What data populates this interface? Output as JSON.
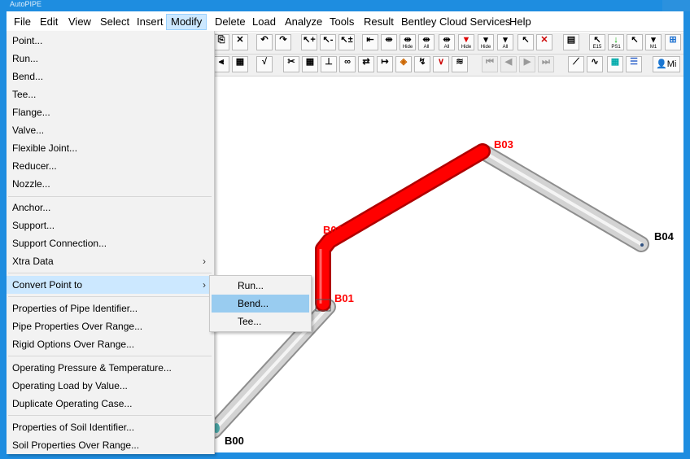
{
  "window": {
    "title": "AutoPIPE"
  },
  "menu_bar": [
    "File",
    "Edit",
    "View",
    "Select",
    "Insert",
    "Modify",
    "Delete",
    "Load",
    "Analyze",
    "Tools",
    "Result",
    "Bentley Cloud Services",
    "Help"
  ],
  "active_menu": "Modify",
  "modify_menu": {
    "group1": [
      "Point...",
      "Run...",
      "Bend...",
      "Tee...",
      "Flange...",
      "Valve...",
      "Flexible Joint...",
      "Reducer...",
      "Nozzle..."
    ],
    "group2": [
      "Anchor...",
      "Support...",
      "Support Connection...",
      "Xtra Data"
    ],
    "group3": [
      "Convert Point to"
    ],
    "group4": [
      "Properties of Pipe Identifier...",
      "Pipe Properties Over Range...",
      "Rigid Options Over Range..."
    ],
    "group5": [
      "Operating Pressure & Temperature...",
      "Operating Load by Value...",
      "Duplicate Operating Case..."
    ],
    "group6": [
      "Properties of Soil Identifier...",
      "Soil Properties Over Range..."
    ]
  },
  "convert_submenu": {
    "items": [
      "Run...",
      "Bend...",
      "Tee..."
    ],
    "highlighted": "Bend..."
  },
  "toolbar_labels": {
    "hide": "Hide",
    "all": "All",
    "e15": "E15",
    "ps1": "PS1",
    "m1": "M1",
    "more": "Mi"
  },
  "model_nodes": {
    "b00": "B00",
    "b01": "B01",
    "b02": "B02",
    "b03": "B03",
    "b04": "B04"
  },
  "colors": {
    "selected_pipe": "#ff0000",
    "pipe": "#c8c8c8",
    "label_selected": "#ff0000",
    "label_normal": "#000000",
    "menu_highlight": "#cce8ff",
    "window_border": "#1e8de0"
  }
}
